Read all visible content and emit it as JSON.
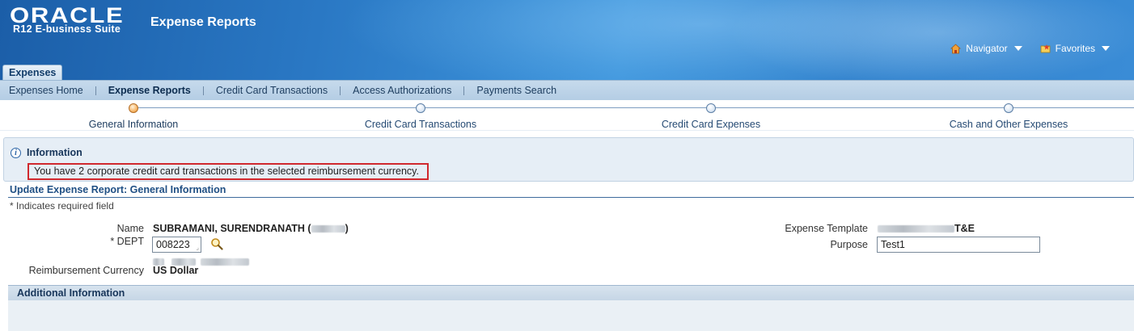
{
  "header": {
    "brand": "ORACLE",
    "suite": "R12 E-business Suite",
    "app_title": "Expense Reports",
    "navigator_label": "Navigator",
    "favorites_label": "Favorites",
    "tab_label": "Expenses"
  },
  "subnav": {
    "items": [
      {
        "label": "Expenses Home"
      },
      {
        "label": "Expense Reports"
      },
      {
        "label": "Credit Card Transactions"
      },
      {
        "label": "Access Authorizations"
      },
      {
        "label": "Payments Search"
      }
    ],
    "active_index": 1
  },
  "train": {
    "steps": [
      {
        "label": "General Information"
      },
      {
        "label": "Credit Card Transactions"
      },
      {
        "label": "Credit Card Expenses"
      },
      {
        "label": "Cash and Other Expenses"
      }
    ],
    "current_index": 0
  },
  "info": {
    "title": "Information",
    "message": "You have 2 corporate credit card transactions in the selected reimbursement currency."
  },
  "page": {
    "title": "Update Expense Report: General Information",
    "required_note": "* Indicates required field"
  },
  "form": {
    "name_label": "Name",
    "name_value": "SUBRAMANI, SURENDRANATH (",
    "name_suffix": ")",
    "dept_label": "* DEPT",
    "dept_value": "008223",
    "currency_label": "Reimbursement Currency",
    "currency_value": "US Dollar",
    "template_label": "Expense Template",
    "template_value_suffix": "T&E",
    "purpose_label": "Purpose",
    "purpose_value": "Test1"
  },
  "additional": {
    "title": "Additional Information"
  },
  "colors": {
    "header_blue": "#2a78c4",
    "subnav_bg": "#c6daec",
    "highlight_border": "#d0282e",
    "current_step": "#f6b76a"
  }
}
